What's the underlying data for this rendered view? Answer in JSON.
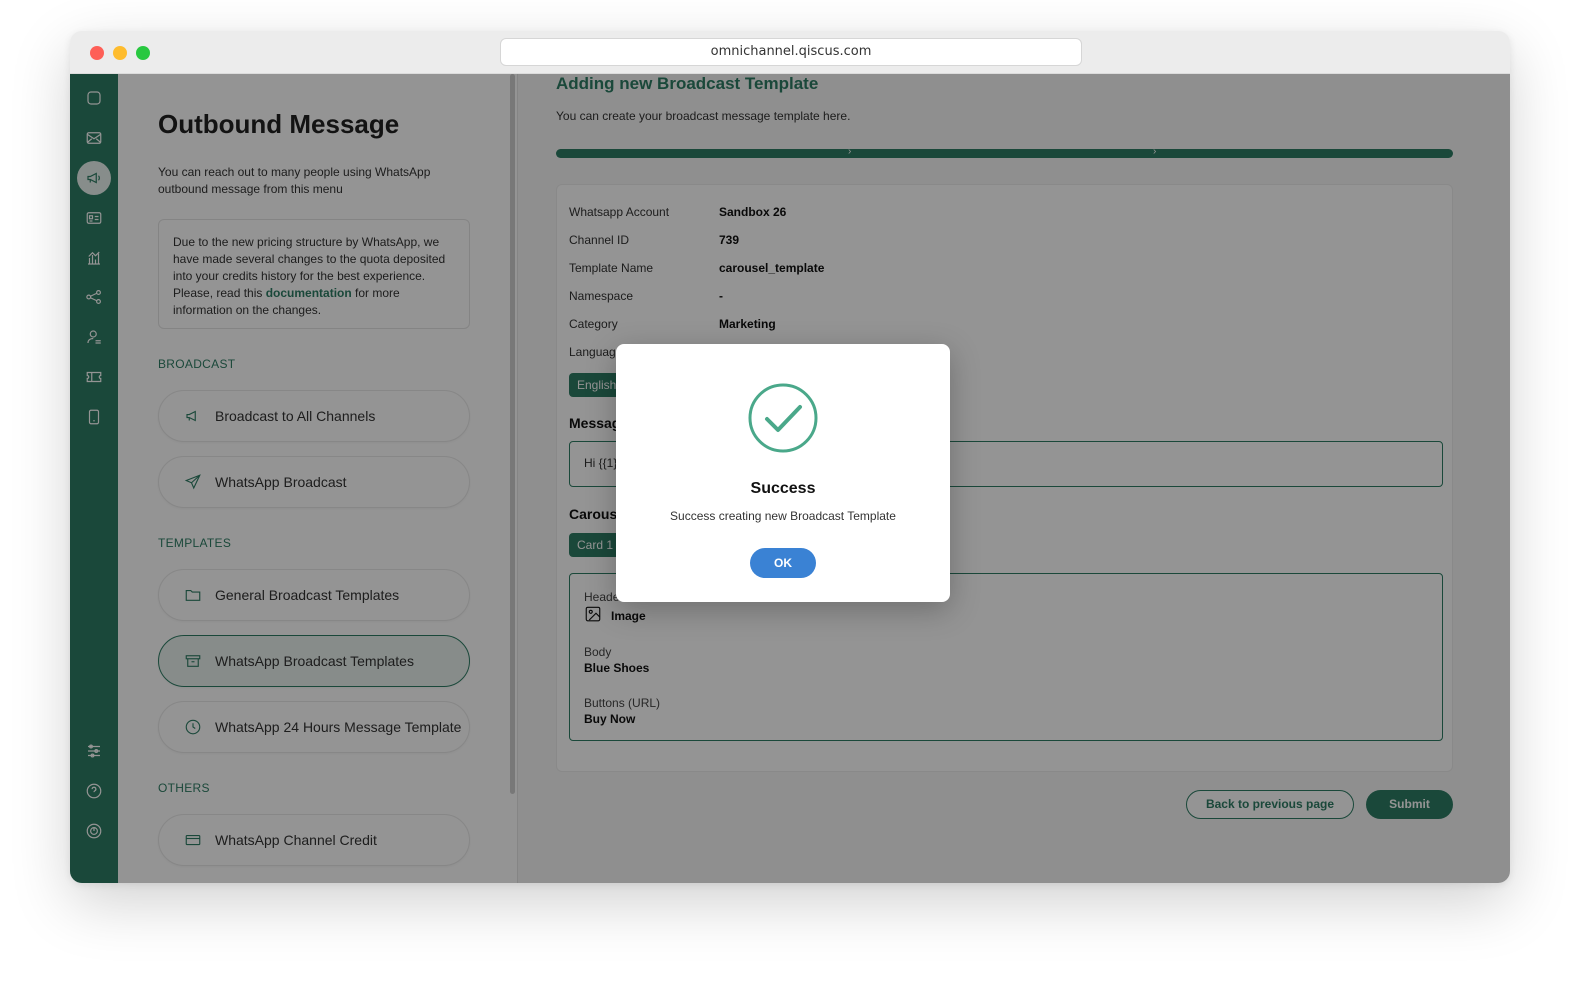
{
  "browser": {
    "url": "omnichannel.qiscus.com"
  },
  "rail": {
    "icons": [
      "chat-icon",
      "inbox-icon",
      "megaphone-icon",
      "contact-card-icon",
      "analytics-icon",
      "integration-icon",
      "agent-icon",
      "ticket-icon",
      "mobile-icon",
      "settings-sliders-icon",
      "help-icon",
      "power-icon"
    ],
    "active": "megaphone-icon"
  },
  "sidebar": {
    "title": "Outbound Message",
    "description": "You can reach out to many people using WhatsApp outbound message from this menu",
    "notice": {
      "before": "Due to the new pricing structure by WhatsApp, we have made several changes to the quota deposited into your credits history for the best experience. Please, read this ",
      "link": "documentation",
      "after": " for more information on the changes."
    },
    "sections": {
      "broadcast": "BROADCAST",
      "templates": "TEMPLATES",
      "others": "OTHERS"
    },
    "items": {
      "broadcast_all": "Broadcast to All Channels",
      "whatsapp_broadcast": "WhatsApp Broadcast",
      "general_templates": "General Broadcast Templates",
      "whatsapp_templates": "WhatsApp Broadcast Templates",
      "whatsapp_24h": "WhatsApp 24 Hours Message Template",
      "channel_credit": "WhatsApp Channel Credit"
    }
  },
  "main": {
    "title": "Adding new Broadcast Template",
    "subtitle": "You can create your broadcast message template here.",
    "progress_steps": 3,
    "progress_completed": 3,
    "details": {
      "whatsapp_account": {
        "label": "Whatsapp Account",
        "value": "Sandbox 26"
      },
      "channel_id": {
        "label": "Channel ID",
        "value": "739"
      },
      "template_name": {
        "label": "Template Name",
        "value": "carousel_template"
      },
      "namespace": {
        "label": "Namespace",
        "value": "-"
      },
      "category": {
        "label": "Category",
        "value": "Marketing"
      },
      "language": {
        "label": "Language"
      }
    },
    "language_tag": "English",
    "message_heading": "Message",
    "message_preview": "Hi {{1}}",
    "carousel_heading": "Carousel",
    "card_tab": "Card 1",
    "card": {
      "header_label": "Header",
      "header_value": "Image",
      "body_label": "Body",
      "body_value": "Blue Shoes",
      "buttons_label": "Buttons (URL)",
      "buttons_value": "Buy Now"
    },
    "back_button": "Back to previous page",
    "submit_button": "Submit"
  },
  "modal": {
    "title": "Success",
    "message": "Success creating new Broadcast Template",
    "ok": "OK"
  }
}
